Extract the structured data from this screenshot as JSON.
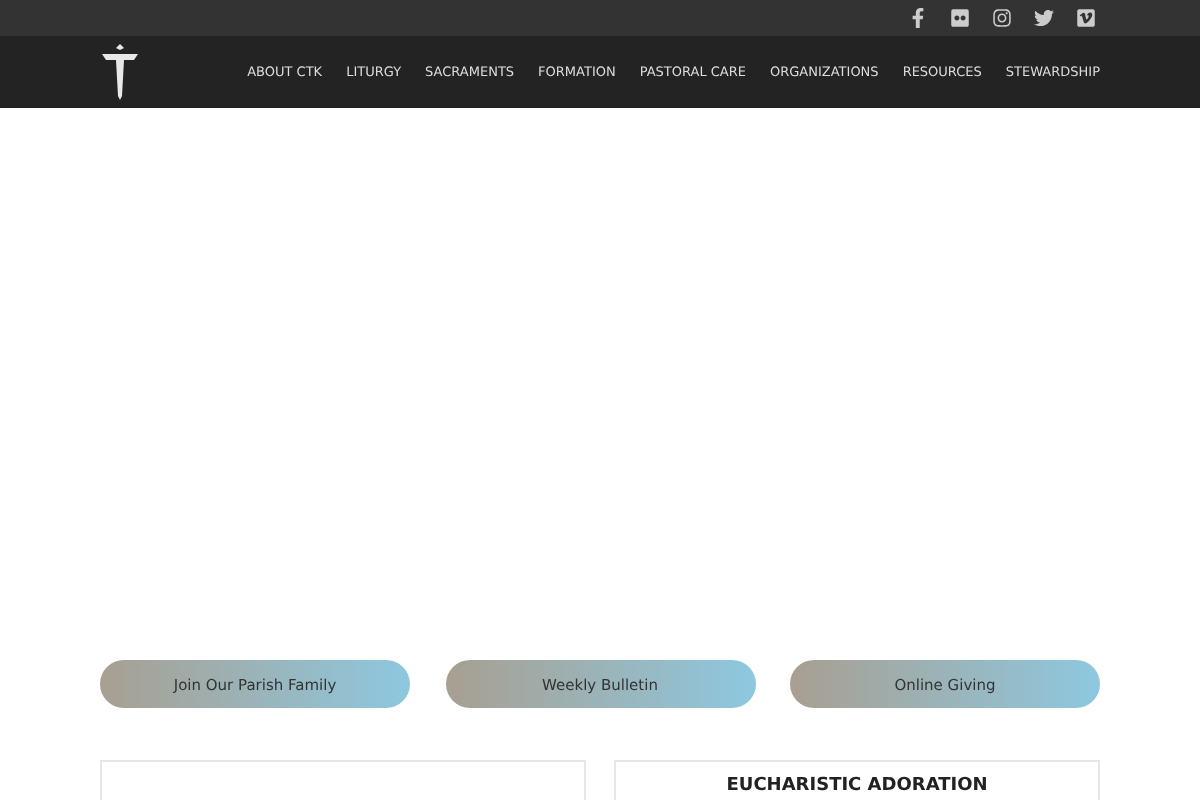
{
  "social": [
    {
      "kind": "facebook"
    },
    {
      "kind": "flickr"
    },
    {
      "kind": "instagram"
    },
    {
      "kind": "twitter"
    },
    {
      "kind": "vimeo"
    }
  ],
  "nav": [
    "ABOUT CTK",
    "LITURGY",
    "SACRAMENTS",
    "FORMATION",
    "PASTORAL CARE",
    "ORGANIZATIONS",
    "RESOURCES",
    "STEWARDSHIP"
  ],
  "buttons": [
    "Join Our Parish Family",
    "Weekly Bulletin",
    "Online Giving"
  ],
  "cards": [
    {
      "kind": "blank"
    },
    {
      "kind": "titled",
      "title": "EUCHARISTIC ADORATION"
    }
  ]
}
